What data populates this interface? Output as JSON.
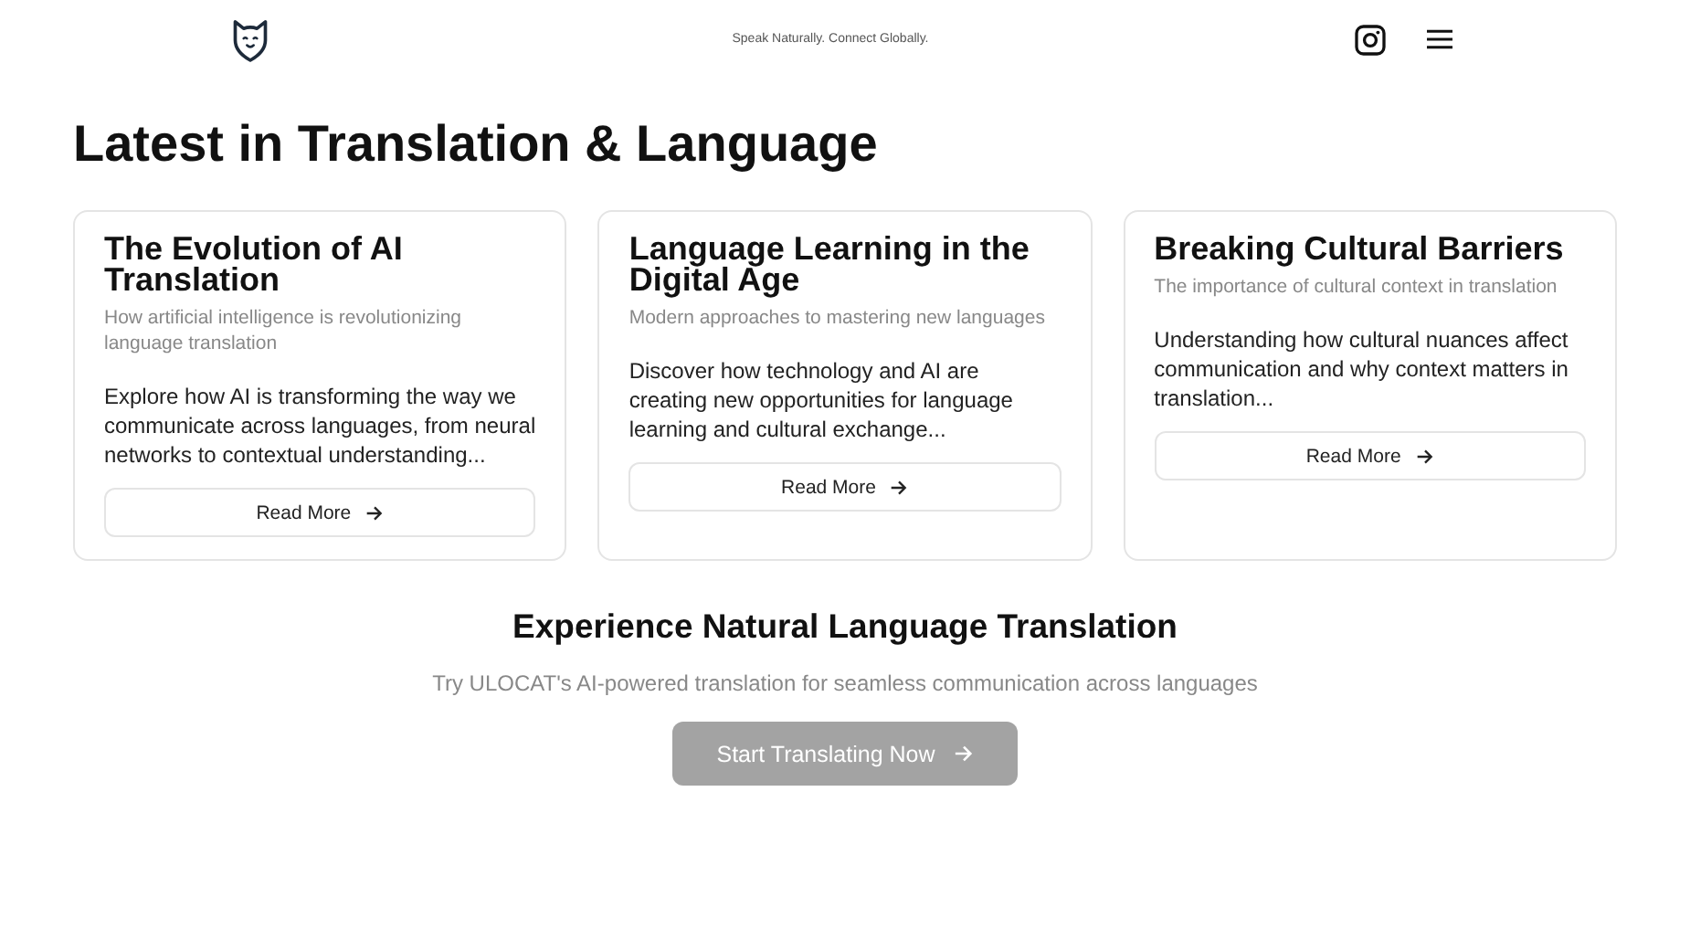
{
  "header": {
    "tagline": "Speak Naturally. Connect Globally."
  },
  "page_title": "Latest in Translation & Language",
  "articles": [
    {
      "title": "The Evolution of AI Translation",
      "subtitle": "How artificial intelligence is revolutionizing language translation",
      "excerpt": "Explore how AI is transforming the way we communicate across languages, from neural networks to contextual understanding...",
      "button": "Read More"
    },
    {
      "title": "Language Learning in the Digital Age",
      "subtitle": "Modern approaches to mastering new languages",
      "excerpt": "Discover how technology and AI are creating new opportunities for language learning and cultural exchange...",
      "button": "Read More"
    },
    {
      "title": "Breaking Cultural Barriers",
      "subtitle": "The importance of cultural context in translation",
      "excerpt": "Understanding how cultural nuances affect communication and why context matters in translation...",
      "button": "Read More"
    }
  ],
  "cta": {
    "title": "Experience Natural Language Translation",
    "text": "Try ULOCAT's AI-powered translation for seamless communication across languages",
    "button": "Start Translating Now"
  }
}
